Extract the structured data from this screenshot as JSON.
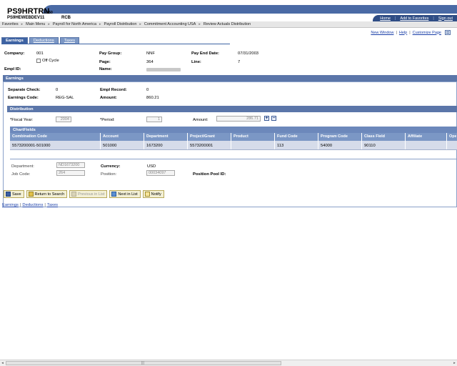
{
  "banner": {
    "title": "PS9HRTRN",
    "version": "8.50",
    "database": "PS9HEWEBDEV11",
    "user": "RCB",
    "links": [
      "Home",
      "Add to Favorites",
      "Sign out"
    ]
  },
  "breadcrumb": [
    "Favorites",
    "Main Menu",
    "Payroll for North America",
    "Payroll Distribution",
    "Commitment Accounting USA",
    "Review Actuals Distribution"
  ],
  "utility_links": [
    "New Window",
    "Help",
    "Customize Page"
  ],
  "tabs": [
    {
      "label": "Earnings",
      "active": true
    },
    {
      "label": "Deductions",
      "active": false
    },
    {
      "label": "Taxes",
      "active": false
    }
  ],
  "header_fields": {
    "company_label": "Company:",
    "company_value": "001",
    "off_cycle_label": "Off Cycle",
    "empl_id_label": "Empl ID:",
    "pay_group_label": "Pay Group:",
    "pay_group_value": "NNF",
    "page_label": "Page:",
    "page_value": "364",
    "name_label": "Name:",
    "pay_end_date_label": "Pay End Date:",
    "pay_end_date_value": "07/31/2003",
    "line_label": "Line:",
    "line_value": "7"
  },
  "earnings": {
    "section_title": "Earnings",
    "separate_check_label": "Separate Check:",
    "separate_check_value": "0",
    "empl_record_label": "Empl Record:",
    "empl_record_value": "0",
    "earnings_code_label": "Earnings Code:",
    "earnings_code_value": "REG-SAL",
    "amount_label": "Amount:",
    "amount_value": "860.21"
  },
  "distribution": {
    "section_title": "Distribution",
    "fiscal_year_label": "*Fiscal Year:",
    "fiscal_year_value": "2004",
    "period_label": "*Period:",
    "period_value": "1",
    "amount_label": "Amount:",
    "amount_value": "286.71",
    "add_symbol": "+",
    "remove_symbol": "−"
  },
  "chartfields": {
    "title": "ChartFields",
    "columns": [
      "Combination Code",
      "Account",
      "Department",
      "Project/Grant",
      "Product",
      "Fund Code",
      "Program Code",
      "Class Field",
      "Affiliate",
      "Ope"
    ],
    "rows": [
      [
        "5573200001-501000",
        "501000",
        "1673200",
        "5573200001",
        "",
        "113",
        "54000",
        "90110",
        "",
        ""
      ]
    ]
  },
  "lower_fields": {
    "department_label": "Department:",
    "department_value": "ND1673200",
    "currency_label": "Currency:",
    "currency_value": "USD",
    "job_code_label": "Job Code:",
    "job_code_value": "264",
    "position_label": "Position:",
    "position_value": "00034097",
    "position_pool_label": "Position Pool ID:"
  },
  "toolbar": {
    "save": "Save",
    "return_to_search": "Return to Search",
    "previous_in_list": "Previous in List",
    "next_in_list": "Next in List",
    "notify": "Notify"
  },
  "bottom_links": [
    "Earnings",
    "Deductions",
    "Taxes"
  ],
  "colors": {
    "banner_blue": "#4a6aa5",
    "section_blue": "#5b76a9",
    "grid_header": "#7b97c5",
    "grid_row": "#d6dcea",
    "link_blue": "#1a3fa8"
  }
}
